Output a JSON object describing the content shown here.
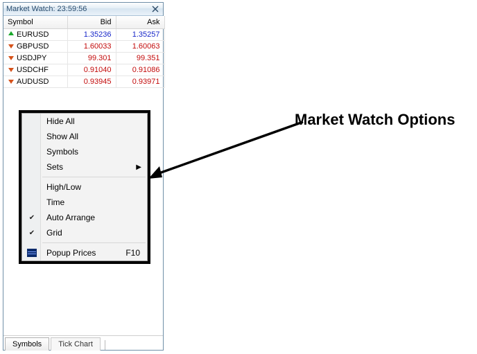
{
  "panel": {
    "title": "Market Watch: 23:59:56"
  },
  "columns": {
    "symbol": "Symbol",
    "bid": "Bid",
    "ask": "Ask"
  },
  "rows": [
    {
      "dir": "up",
      "symbol": "EURUSD",
      "bid": "1.35236",
      "ask": "1.35257"
    },
    {
      "dir": "down",
      "symbol": "GBPUSD",
      "bid": "1.60033",
      "ask": "1.60063"
    },
    {
      "dir": "down",
      "symbol": "USDJPY",
      "bid": "99.301",
      "ask": "99.351"
    },
    {
      "dir": "down",
      "symbol": "USDCHF",
      "bid": "0.91040",
      "ask": "0.91086"
    },
    {
      "dir": "down",
      "symbol": "AUDUSD",
      "bid": "0.93945",
      "ask": "0.93971"
    }
  ],
  "menu": {
    "hide_all": "Hide All",
    "show_all": "Show All",
    "symbols": "Symbols",
    "sets": "Sets",
    "high_low": "High/Low",
    "time": "Time",
    "auto_arrange": "Auto Arrange",
    "grid": "Grid",
    "popup_prices": "Popup Prices",
    "popup_accel": "F10"
  },
  "tabs": {
    "symbols": "Symbols",
    "tick_chart": "Tick Chart"
  },
  "annotation": "Market Watch Options",
  "colors": {
    "up": "#1726c9",
    "down": "#c30b0b"
  }
}
